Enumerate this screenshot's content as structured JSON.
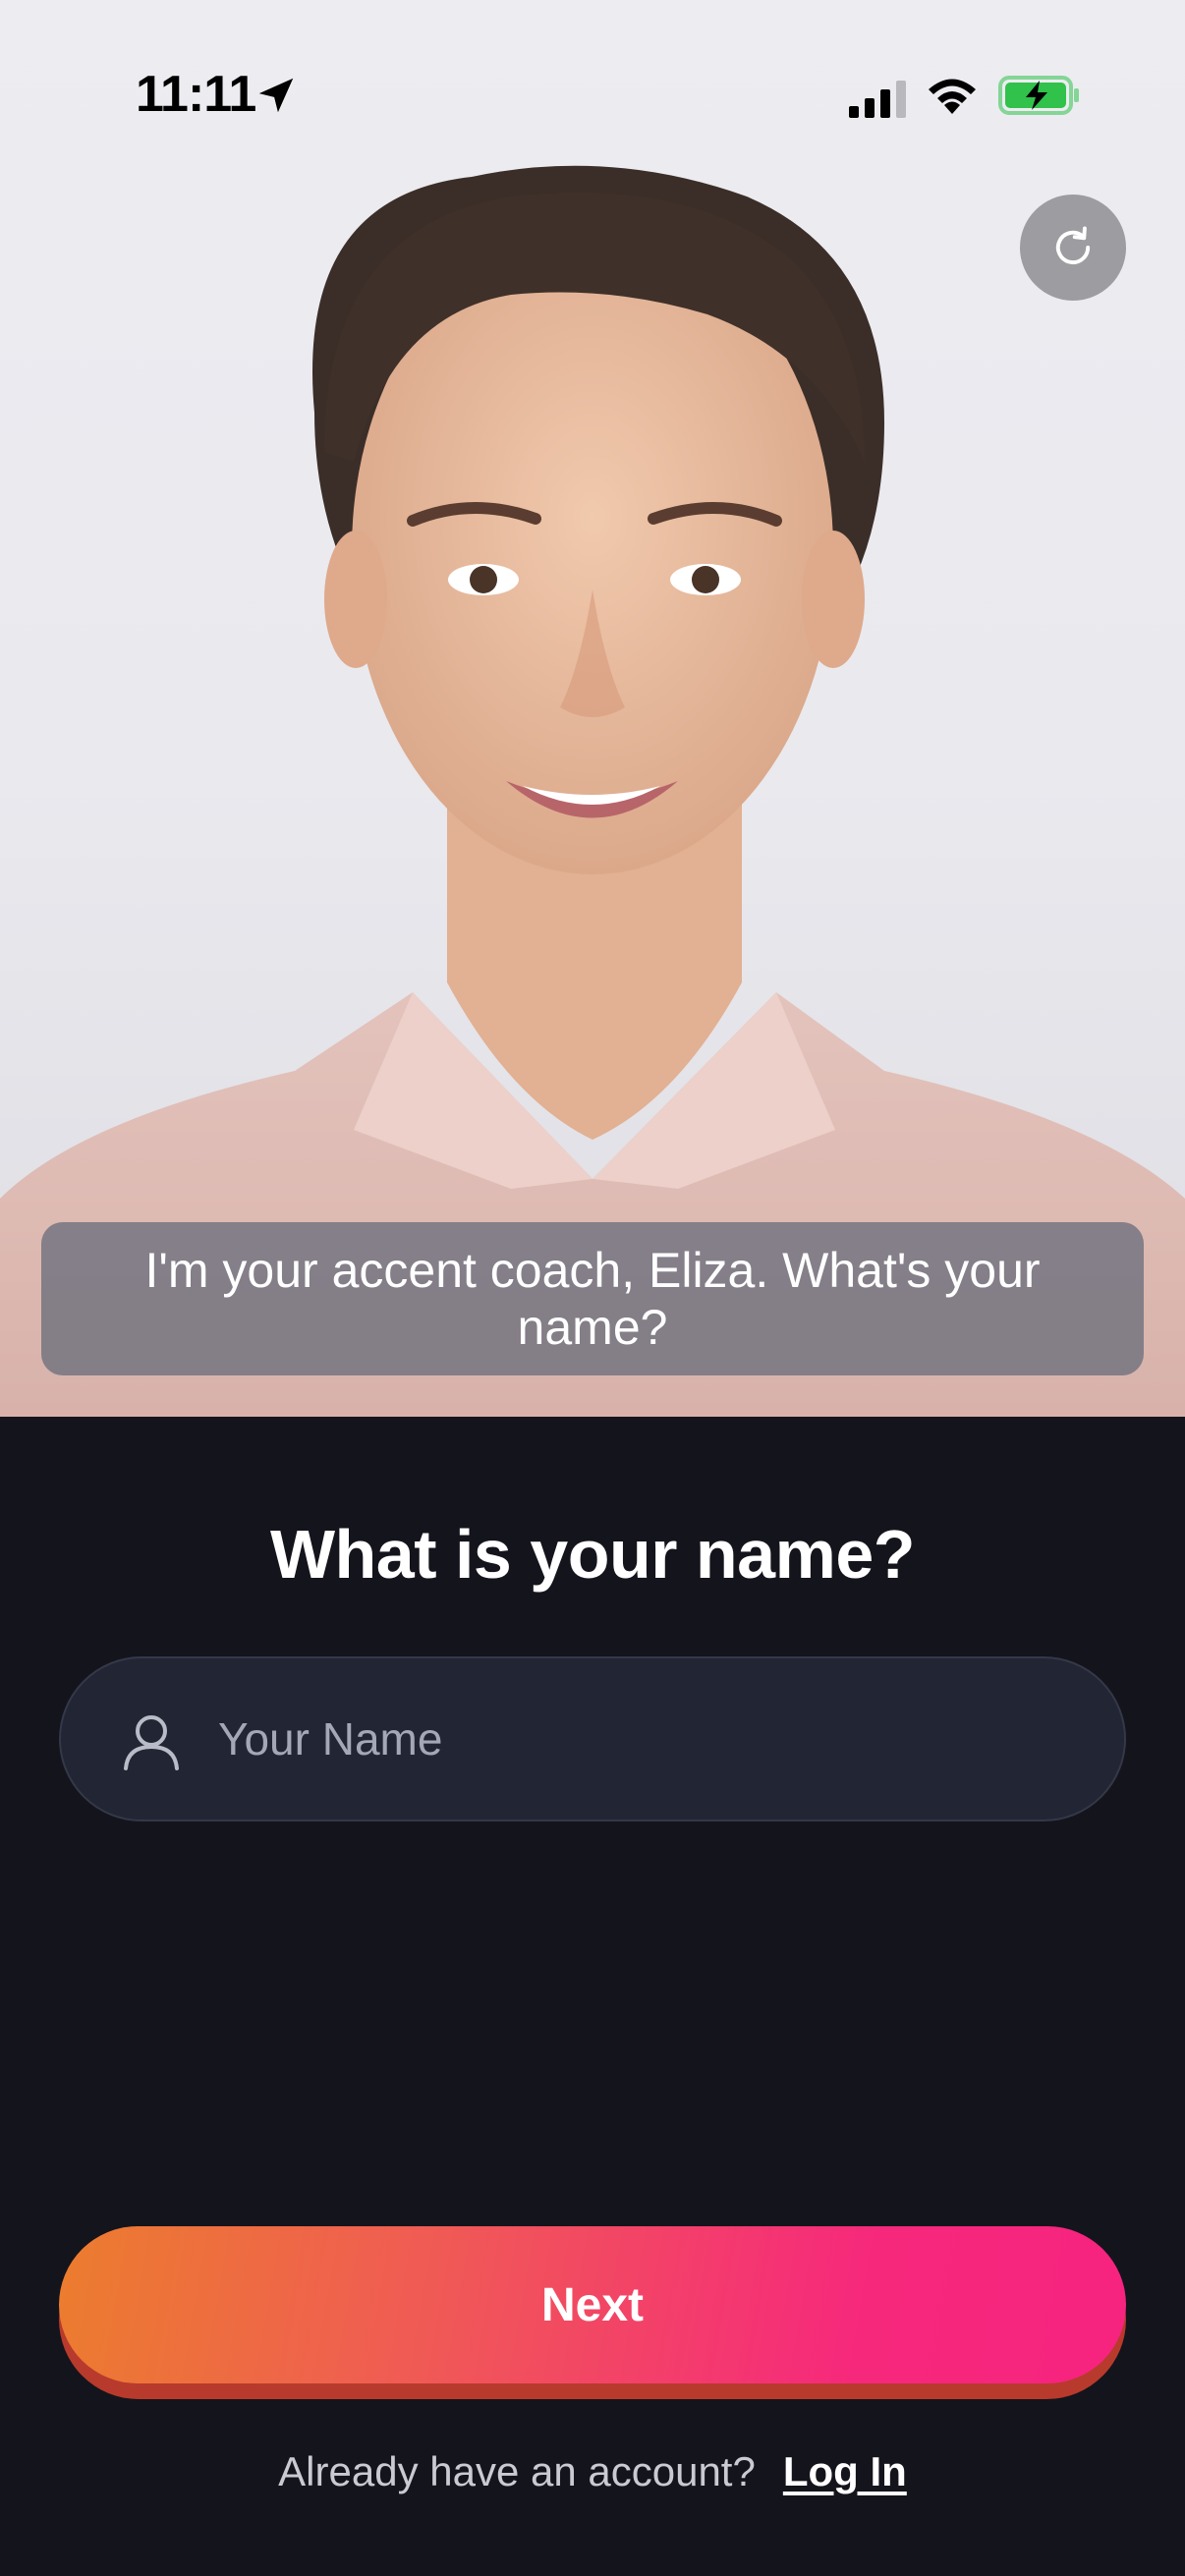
{
  "status_bar": {
    "time": "11:11",
    "icons": [
      "location-arrow-icon",
      "cellular-signal-icon",
      "wifi-icon",
      "battery-charging-icon"
    ],
    "battery_color": "#30c24b"
  },
  "video": {
    "refresh_icon": "refresh-icon",
    "caption": "I'm your accent coach, Eliza. What's your name?"
  },
  "form": {
    "question": "What is your name?",
    "name_placeholder": "Your Name",
    "name_value": "",
    "field_icon": "user-icon"
  },
  "actions": {
    "next_label": "Next",
    "login_prompt": "Already have an account?",
    "login_label": "Log In"
  },
  "colors": {
    "background": "#14141c",
    "field_background": "#222533",
    "button_gradient_start": "#ec7d2e",
    "button_gradient_end": "#f6237f"
  }
}
